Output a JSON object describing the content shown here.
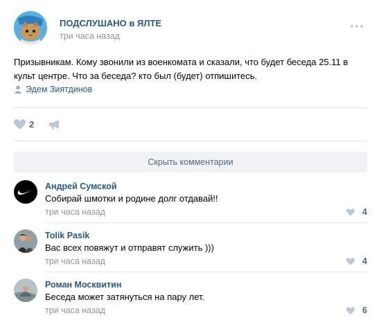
{
  "post": {
    "group_name": "ПОДСЛУШАНО в ЯЛТЕ",
    "time": "три часа назад",
    "text": "Призывникам. Кому звонили из военкомата и сказали, что будет беседа 25.11 в культ центре. Что за беседа? кто был (будет) отпишитесь.",
    "author": "Эдем Зиятдинов",
    "likes": "2",
    "icons": {
      "menu": "more-dots-icon",
      "author": "person-icon",
      "like": "heart-icon",
      "share": "megaphone-icon"
    }
  },
  "comments_toggle": {
    "label": "Скрыть комментарии"
  },
  "comments": [
    {
      "author": "Андрей Сумской",
      "text": "Собирай шмотки и родине долг отдавай!!",
      "time": "три часа назад",
      "likes": "4"
    },
    {
      "author": "Tolik Pasik",
      "text": "Вас всех повяжут и отправят служить )))",
      "time": "три часа назад",
      "likes": "4"
    },
    {
      "author": "Роман Москвитин",
      "text": "Беседа может затянуться на пару лет.",
      "time": "три часа назад",
      "likes": "6"
    }
  ],
  "colors": {
    "link": "#2a5885",
    "muted": "#939393",
    "like_icon": "#bdc8d6",
    "button_bg": "#f0f2f5"
  }
}
